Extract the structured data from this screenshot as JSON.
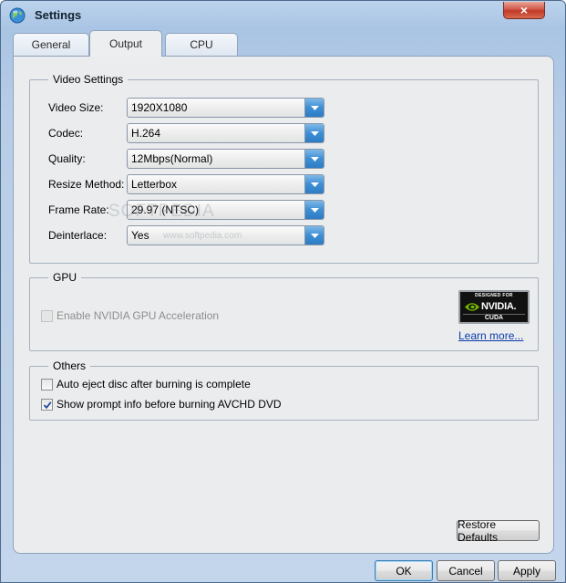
{
  "window": {
    "title": "Settings",
    "close_label": "×"
  },
  "tabs": [
    {
      "label": "General",
      "active": false
    },
    {
      "label": "Output",
      "active": true
    },
    {
      "label": "CPU",
      "active": false
    }
  ],
  "video_settings": {
    "legend": "Video Settings",
    "rows": [
      {
        "label": "Video Size:",
        "value": "1920X1080"
      },
      {
        "label": "Codec:",
        "value": "H.264"
      },
      {
        "label": "Quality:",
        "value": "12Mbps(Normal)"
      },
      {
        "label": "Resize Method:",
        "value": "Letterbox"
      },
      {
        "label": "Frame Rate:",
        "value": "29.97 (NTSC)"
      },
      {
        "label": "Deinterlace:",
        "value": "Yes"
      }
    ]
  },
  "gpu": {
    "legend": "GPU",
    "checkbox_label": "Enable NVIDIA GPU Acceleration",
    "checked": false,
    "enabled": false,
    "logo": {
      "top": "DESIGNED FOR",
      "brand": "NVIDIA.",
      "bottom": "CUDA"
    },
    "learn_more": "Learn more..."
  },
  "others": {
    "legend": "Others",
    "auto_eject_label": "Auto eject disc after burning is complete",
    "auto_eject_checked": false,
    "show_prompt_label": "Show prompt info before burning AVCHD DVD",
    "show_prompt_checked": true
  },
  "buttons": {
    "restore_defaults": "Restore Defaults",
    "ok": "OK",
    "cancel": "Cancel",
    "apply": "Apply"
  },
  "watermark": {
    "text": "SOFTPEDIA",
    "url": "www.softpedia.com"
  },
  "colors": {
    "combo_arrow": "#3d8ed4",
    "nvidia_green": "#76b900",
    "link": "#0a3ba8",
    "close_button": "#c9432f"
  }
}
